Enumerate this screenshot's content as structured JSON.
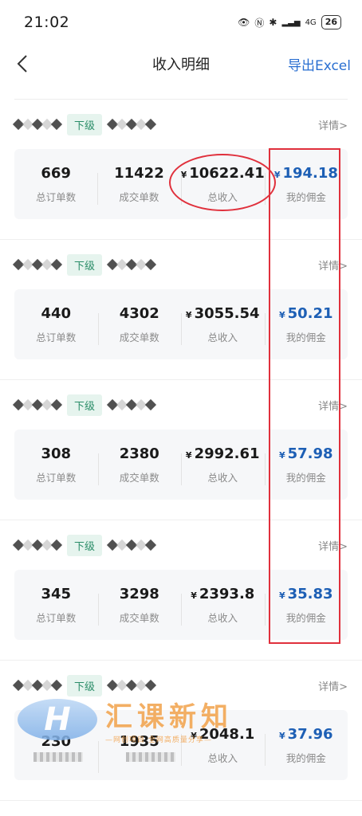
{
  "status_bar": {
    "time": "21:02",
    "battery": "26",
    "network": "4G"
  },
  "header": {
    "back_icon": "chevron-left-icon",
    "title": "收入明细",
    "export_label": "导出Excel"
  },
  "sections": [
    {
      "tag": "下级",
      "detail": "详情>",
      "total_orders": "669",
      "deal_orders": "11422",
      "income_symbol": "¥",
      "income": "10622.41",
      "commission_symbol": "¥",
      "commission": "194.18",
      "labels": {
        "total_orders": "总订单数",
        "deal_orders": "成交单数",
        "income": "总收入",
        "commission": "我的佣金"
      }
    },
    {
      "tag": "下级",
      "detail": "详情>",
      "total_orders": "440",
      "deal_orders": "4302",
      "income_symbol": "¥",
      "income": "3055.54",
      "commission_symbol": "¥",
      "commission": "50.21",
      "labels": {
        "total_orders": "总订单数",
        "deal_orders": "成交单数",
        "income": "总收入",
        "commission": "我的佣金"
      }
    },
    {
      "tag": "下级",
      "detail": "详情>",
      "total_orders": "308",
      "deal_orders": "2380",
      "income_symbol": "¥",
      "income": "2992.61",
      "commission_symbol": "¥",
      "commission": "57.98",
      "labels": {
        "total_orders": "总订单数",
        "deal_orders": "成交单数",
        "income": "总收入",
        "commission": "我的佣金"
      }
    },
    {
      "tag": "下级",
      "detail": "详情>",
      "total_orders": "345",
      "deal_orders": "3298",
      "income_symbol": "¥",
      "income": "2393.8",
      "commission_symbol": "¥",
      "commission": "35.83",
      "labels": {
        "total_orders": "总订单数",
        "deal_orders": "成交单数",
        "income": "总收入",
        "commission": "我的佣金"
      }
    },
    {
      "tag": "下级",
      "detail": "详情>",
      "total_orders": "230",
      "deal_orders": "1935",
      "income_symbol": "¥",
      "income": "2048.1",
      "commission_symbol": "¥",
      "commission": "37.96",
      "labels": {
        "total_orders": "",
        "deal_orders": "",
        "income": "总收入",
        "commission": "我的佣金"
      }
    }
  ],
  "watermark": {
    "logo": "H",
    "title": "汇课新知",
    "subtitle": "—网创项目 全网高质量分享—"
  },
  "colors": {
    "accent_blue": "#2a6fd1",
    "commission_blue": "#1d5fb5",
    "tag_green": "#2a8d68",
    "annotation_red": "#e0303c"
  }
}
